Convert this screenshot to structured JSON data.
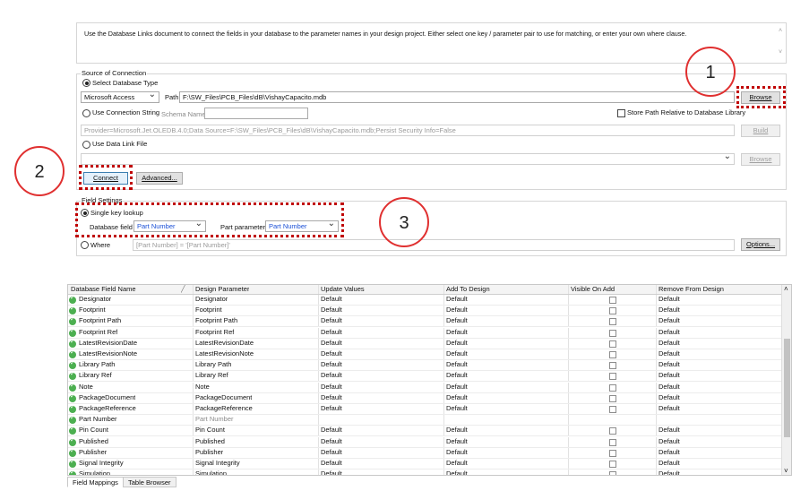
{
  "description": {
    "text": "Use the Database Links document to connect the fields in your database to the parameter names in your design project. Either select one key / parameter pair to use for matching, or enter your own where clause."
  },
  "connection": {
    "group_title": "Source of Connection",
    "select_db_type_label": "Select Database Type",
    "db_type_value": "Microsoft Access",
    "path_label": "Path",
    "path_value": "F:\\SW_Files\\PCB_Files\\dB\\VishayCapacito.mdb",
    "browse_label": "Browse",
    "use_conn_string_label": "Use Connection String",
    "schema_name_placeholder": "Schema Name",
    "store_path_label": "Store Path Relative to Database Library",
    "conn_string_value": "Provider=Microsoft.Jet.OLEDB.4.0;Data Source=F:\\SW_Files\\PCB_Files\\dB\\VishayCapacito.mdb;Persist Security Info=False",
    "build_label": "Build",
    "use_data_link_label": "Use Data Link File",
    "browse2_label": "Browse",
    "connect_label": "Connect",
    "advanced_label": "Advanced..."
  },
  "field_settings": {
    "group_title": "Field Settings",
    "single_key_label": "Single key lookup",
    "database_field_label": "Database field",
    "database_field_value": "Part Number",
    "part_parameter_label": "Part parameter",
    "part_parameter_value": "Part Number",
    "where_label": "Where",
    "where_value": "[Part Number] = '[Part Number]'",
    "options_label": "Options..."
  },
  "annotations": [
    "1",
    "2",
    "3"
  ],
  "table": {
    "headers": [
      "Database Field Name",
      "Design Parameter",
      "Update Values",
      "Add To Design",
      "Visible On Add",
      "Remove From Design"
    ],
    "rows": [
      [
        "Designator",
        "Designator",
        "Default",
        "Default",
        "",
        "Default"
      ],
      [
        "Footprint",
        "Footprint",
        "Default",
        "Default",
        "",
        "Default"
      ],
      [
        "Footprint Path",
        "Footprint Path",
        "Default",
        "Default",
        "",
        "Default"
      ],
      [
        "Footprint Ref",
        "Footprint Ref",
        "Default",
        "Default",
        "",
        "Default"
      ],
      [
        "LatestRevisionDate",
        "LatestRevisionDate",
        "Default",
        "Default",
        "",
        "Default"
      ],
      [
        "LatestRevisionNote",
        "LatestRevisionNote",
        "Default",
        "Default",
        "",
        "Default"
      ],
      [
        "Library Path",
        "Library Path",
        "Default",
        "Default",
        "",
        "Default"
      ],
      [
        "Library Ref",
        "Library Ref",
        "Default",
        "Default",
        "",
        "Default"
      ],
      [
        "Note",
        "Note",
        "Default",
        "Default",
        "",
        "Default"
      ],
      [
        "PackageDocument",
        "PackageDocument",
        "Default",
        "Default",
        "",
        "Default"
      ],
      [
        "PackageReference",
        "PackageReference",
        "Default",
        "Default",
        "",
        "Default"
      ],
      [
        "Part Number",
        "Part Number",
        "",
        "",
        "",
        ""
      ],
      [
        "Pin Count",
        "Pin Count",
        "Default",
        "Default",
        "",
        "Default"
      ],
      [
        "Published",
        "Published",
        "Default",
        "Default",
        "",
        "Default"
      ],
      [
        "Publisher",
        "Publisher",
        "Default",
        "Default",
        "",
        "Default"
      ],
      [
        "Signal Integrity",
        "Signal Integrity",
        "Default",
        "Default",
        "",
        "Default"
      ],
      [
        "Simulation",
        "Simulation",
        "Default",
        "Default",
        "",
        "Default"
      ]
    ]
  },
  "tabs": [
    "Field Mappings",
    "Table Browser"
  ],
  "colors": {
    "annotation_red": "#c00000",
    "ok_green": "#4caf50",
    "link_blue": "#1a4fd6"
  }
}
